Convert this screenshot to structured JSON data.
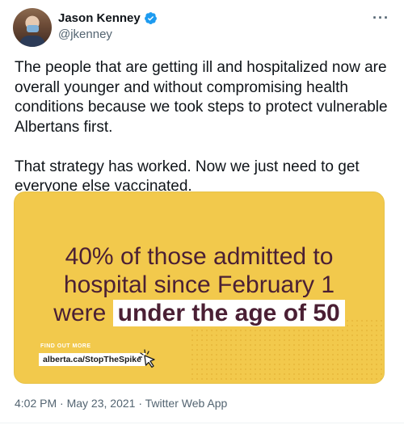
{
  "author": {
    "name": "Jason Kenney",
    "handle": "@jkenney",
    "verified": true,
    "verified_color": "#1d9bf0"
  },
  "menu_icon": "more-horizontal-icon",
  "tweet": {
    "text": "The people that are getting ill and hospitalized now are overall younger and without compromising health conditions because we took steps to protect vulnerable Albertans first.\n\nThat strategy has worked. Now we just need to get everyone else vaccinated."
  },
  "media": {
    "background_color": "#f2c94c",
    "text_color": "#4a1f34",
    "headline_lines": [
      "40% of those admitted to",
      "hospital since February 1"
    ],
    "headline_last_prefix": "were",
    "headline_highlight": "under the age of 50",
    "find_out_more": "FIND OUT MORE",
    "url": "alberta.ca/StopTheSpike"
  },
  "meta": {
    "time": "4:02 PM",
    "date": "May 23, 2021",
    "source": "Twitter Web App"
  }
}
